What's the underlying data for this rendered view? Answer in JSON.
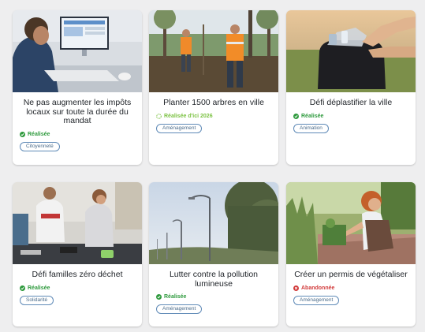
{
  "colors": {
    "done": "#2e9a3d",
    "planned": "#7cc243",
    "abandoned": "#d23c3c",
    "tag_border": "#5f8ab7"
  },
  "cards": [
    {
      "title": "Ne pas augmenter les impôts locaux sur toute la durée du mandat",
      "status": "Réalisée",
      "status_type": "done",
      "status_icon": "check-circle-icon",
      "tag": "Citoyenneté"
    },
    {
      "title": "Planter 1500 arbres en ville",
      "status": "Réalisée d'ici 2026",
      "status_type": "planned",
      "status_icon": "progress-circle-icon",
      "tag": "Aménagement"
    },
    {
      "title": "Défi déplastifier la ville",
      "status": "Réalisée",
      "status_type": "done",
      "status_icon": "check-circle-icon",
      "tag": "Animation"
    },
    {
      "title": "Défi familles zéro déchet",
      "status": "Réalisée",
      "status_type": "done",
      "status_icon": "check-circle-icon",
      "tag": "Solidarité"
    },
    {
      "title": "Lutter contre la pollution lumineuse",
      "status": "Réalisée",
      "status_type": "done",
      "status_icon": "check-circle-icon",
      "tag": "Aménagement"
    },
    {
      "title": "Créer un permis de végétaliser",
      "status": "Abandonnée",
      "status_type": "abandoned",
      "status_icon": "x-circle-icon",
      "tag": "Aménagement"
    }
  ]
}
